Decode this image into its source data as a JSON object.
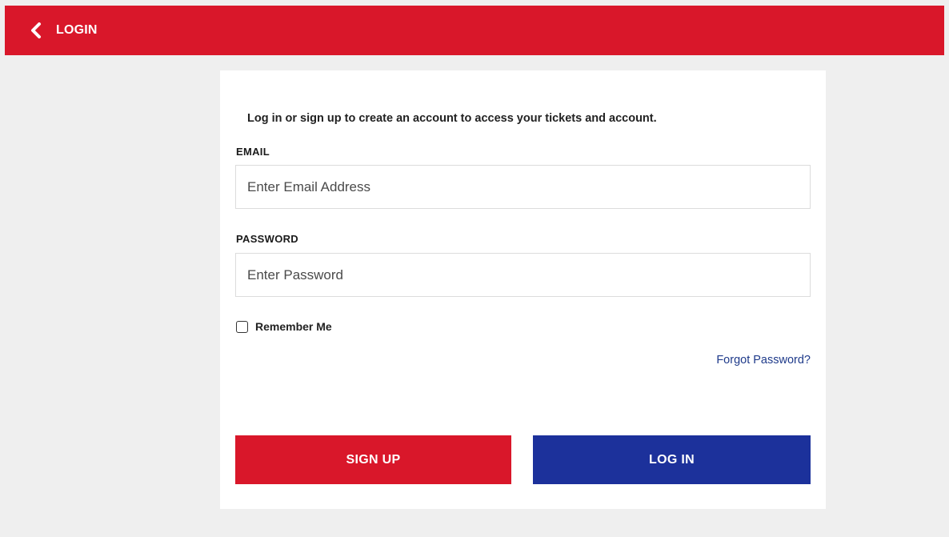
{
  "header": {
    "title": "LOGIN",
    "back_icon": "chevron-left-icon"
  },
  "form": {
    "intro": "Log in or sign up to create an account to access your tickets and account.",
    "email": {
      "label": "EMAIL",
      "placeholder": "Enter Email Address",
      "value": ""
    },
    "password": {
      "label": "PASSWORD",
      "placeholder": "Enter Password",
      "value": ""
    },
    "remember_me": {
      "label": "Remember Me",
      "checked": false
    },
    "forgot_password": "Forgot Password?"
  },
  "actions": {
    "signup_label": "SIGN UP",
    "login_label": "LOG IN"
  },
  "colors": {
    "brand_red": "#d9172a",
    "brand_blue": "#1c319b",
    "link_blue": "#1e3a8a",
    "background": "#efefef"
  }
}
